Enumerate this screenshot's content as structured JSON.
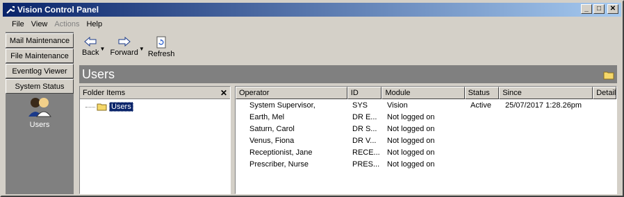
{
  "window": {
    "title": "Vision Control Panel"
  },
  "menu": [
    {
      "label": "File",
      "disabled": false
    },
    {
      "label": "View",
      "disabled": false
    },
    {
      "label": "Actions",
      "disabled": true
    },
    {
      "label": "Help",
      "disabled": false
    }
  ],
  "nav": {
    "buttons": [
      "Mail Maintenance",
      "File Maintenance",
      "Eventlog Viewer",
      "System Status"
    ],
    "users_label": "Users"
  },
  "toolbar": {
    "back": "Back",
    "forward": "Forward",
    "refresh": "Refresh"
  },
  "header": {
    "title": "Users"
  },
  "folder_pane": {
    "title": "Folder Items",
    "close": "✕",
    "tree_item": "Users"
  },
  "list": {
    "columns": [
      "Operator",
      "ID",
      "Module",
      "Status",
      "Since",
      "Detail"
    ],
    "rows": [
      {
        "operator": "System Supervisor,",
        "id": "SYS",
        "module": "Vision",
        "status": "Active",
        "since": "25/07/2017 1:28.26pm"
      },
      {
        "operator": "Earth, Mel",
        "id": "DR E...",
        "module": "Not logged on",
        "status": "",
        "since": ""
      },
      {
        "operator": "Saturn, Carol",
        "id": "DR S...",
        "module": "Not logged on",
        "status": "",
        "since": ""
      },
      {
        "operator": "Venus, Fiona",
        "id": "DR V...",
        "module": "Not logged on",
        "status": "",
        "since": ""
      },
      {
        "operator": "Receptionist, Jane",
        "id": "RECE...",
        "module": "Not logged on",
        "status": "",
        "since": ""
      },
      {
        "operator": "Prescriber, Nurse",
        "id": "PRES...",
        "module": "Not logged on",
        "status": "",
        "since": ""
      }
    ]
  }
}
